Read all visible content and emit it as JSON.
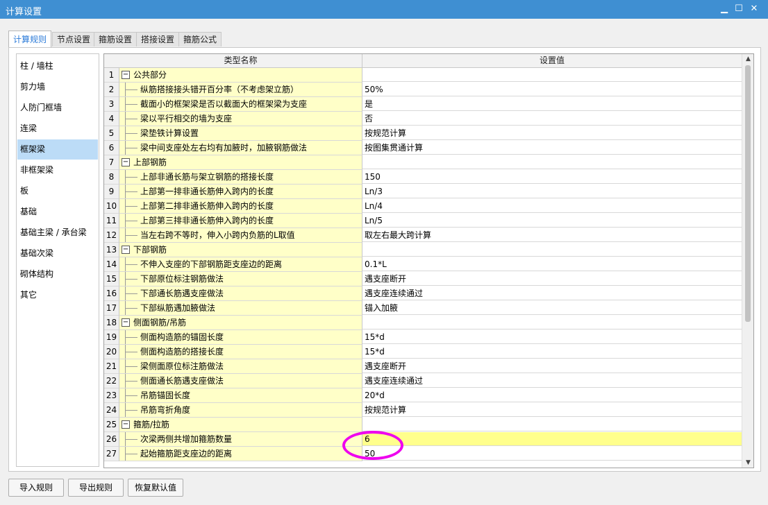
{
  "window": {
    "title": "计算设置",
    "minimize_icon": "minimize-icon",
    "maximize_icon": "maximize-icon",
    "close_icon": "close-icon"
  },
  "tabs": [
    {
      "label": "计算规则",
      "active": true
    },
    {
      "label": "节点设置",
      "active": false
    },
    {
      "label": "箍筋设置",
      "active": false
    },
    {
      "label": "搭接设置",
      "active": false
    },
    {
      "label": "箍筋公式",
      "active": false
    }
  ],
  "sidebar": {
    "selected": "框架梁",
    "items": [
      "柱 / 墙柱",
      "剪力墙",
      "人防门框墙",
      "连梁",
      "框架梁",
      "非框架梁",
      "板",
      "基础",
      "基础主梁 / 承台梁",
      "基础次梁",
      "砌体结构",
      "其它"
    ]
  },
  "grid": {
    "headers": {
      "name": "类型名称",
      "value": "设置值"
    },
    "rows": [
      {
        "num": "1",
        "name": "公共部分",
        "value": "",
        "group": true
      },
      {
        "num": "2",
        "name": "纵筋搭接接头错开百分率（不考虑架立筋）",
        "value": "50%"
      },
      {
        "num": "3",
        "name": "截面小的框架梁是否以截面大的框架梁为支座",
        "value": "是"
      },
      {
        "num": "4",
        "name": "梁以平行相交的墙为支座",
        "value": "否"
      },
      {
        "num": "5",
        "name": "梁垫铁计算设置",
        "value": "按规范计算"
      },
      {
        "num": "6",
        "name": "梁中间支座处左右均有加腋时，加腋钢筋做法",
        "value": "按图集贯通计算"
      },
      {
        "num": "7",
        "name": "上部钢筋",
        "value": "",
        "group": true
      },
      {
        "num": "8",
        "name": "上部非通长筋与架立钢筋的搭接长度",
        "value": "150"
      },
      {
        "num": "9",
        "name": "上部第一排非通长筋伸入跨内的长度",
        "value": "Ln/3"
      },
      {
        "num": "10",
        "name": "上部第二排非通长筋伸入跨内的长度",
        "value": "Ln/4"
      },
      {
        "num": "11",
        "name": "上部第三排非通长筋伸入跨内的长度",
        "value": "Ln/5"
      },
      {
        "num": "12",
        "name": "当左右跨不等时，伸入小跨内负筋的L取值",
        "value": "取左右最大跨计算"
      },
      {
        "num": "13",
        "name": "下部钢筋",
        "value": "",
        "group": true
      },
      {
        "num": "14",
        "name": "不伸入支座的下部钢筋距支座边的距离",
        "value": "0.1*L"
      },
      {
        "num": "15",
        "name": "下部原位标注钢筋做法",
        "value": "遇支座断开"
      },
      {
        "num": "16",
        "name": "下部通长筋遇支座做法",
        "value": "遇支座连续通过"
      },
      {
        "num": "17",
        "name": "下部纵筋遇加腋做法",
        "value": "锚入加腋"
      },
      {
        "num": "18",
        "name": "侧面钢筋/吊筋",
        "value": "",
        "group": true
      },
      {
        "num": "19",
        "name": "侧面构造筋的锚固长度",
        "value": "15*d"
      },
      {
        "num": "20",
        "name": "侧面构造筋的搭接长度",
        "value": "15*d"
      },
      {
        "num": "21",
        "name": "梁侧面原位标注筋做法",
        "value": "遇支座断开"
      },
      {
        "num": "22",
        "name": "侧面通长筋遇支座做法",
        "value": "遇支座连续通过"
      },
      {
        "num": "23",
        "name": "吊筋锚固长度",
        "value": "20*d"
      },
      {
        "num": "24",
        "name": "吊筋弯折角度",
        "value": "按规范计算"
      },
      {
        "num": "25",
        "name": "箍筋/拉筋",
        "value": "",
        "group": true
      },
      {
        "num": "26",
        "name": "次梁两侧共增加箍筋数量",
        "value": "6",
        "highlight": true
      },
      {
        "num": "27",
        "name": "起始箍筋距支座边的距离",
        "value": "50"
      }
    ]
  },
  "buttons": {
    "import": "导入规则",
    "export": "导出规则",
    "restore": "恢复默认值"
  },
  "colors": {
    "titlebar": "#3f8fd2",
    "name_cell": "#ffffc8",
    "highlight": "#ffff8c",
    "annotation": "#ee00ee",
    "sidebar_selected": "#bcdcf7"
  }
}
